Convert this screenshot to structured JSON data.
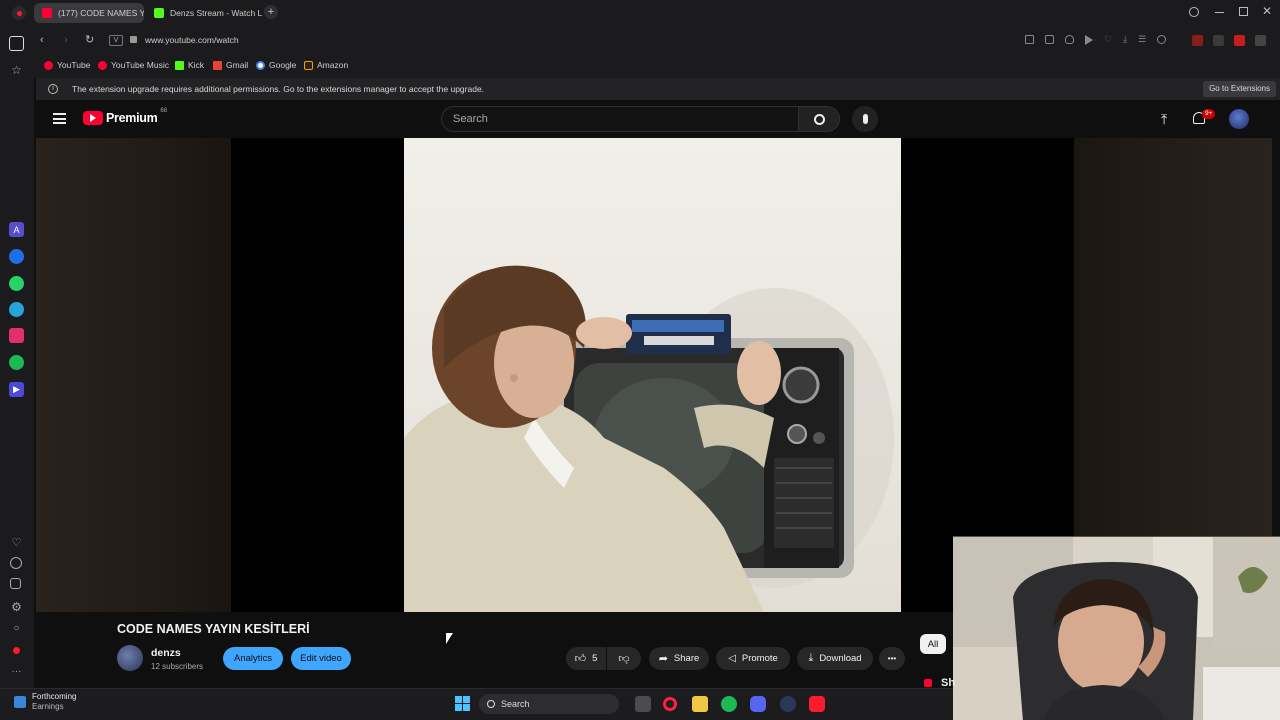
{
  "browser": {
    "tabs": [
      {
        "label": "(177) CODE NAMES Y/",
        "active": true
      },
      {
        "label": "Denzs Stream - Watch Liv",
        "active": false
      }
    ],
    "new_tab": "+",
    "url": "www.youtube.com/watch",
    "bookmarks": [
      {
        "label": "YouTube",
        "color": "#ff0033"
      },
      {
        "label": "YouTube Music",
        "color": "#ff0033"
      },
      {
        "label": "Kick",
        "color": "#53fc18"
      },
      {
        "label": "Gmail",
        "color": "#ea4335"
      },
      {
        "label": "Google",
        "color": "#4285f4"
      },
      {
        "label": "Amazon",
        "color": "#ff9900"
      }
    ],
    "infobar": {
      "message": "The extension upgrade requires additional permissions. Go to the extensions manager to accept the upgrade.",
      "button": "Go to Extensions"
    }
  },
  "youtube": {
    "logo": "Premium",
    "logo_badge": "68",
    "search_placeholder": "Search",
    "notification_count": "9+",
    "video": {
      "title": "CODE NAMES YAYIN KESİTLERİ",
      "channel": "denzs",
      "subscribers": "12 subscribers",
      "analytics": "Analytics",
      "edit": "Edit video",
      "likes": "5",
      "share": "Share",
      "promote": "Promote",
      "download": "Download",
      "more": "•••"
    },
    "chip_all": "All",
    "side_text": "Sh"
  },
  "taskbar": {
    "widget_title": "Forthcoming",
    "widget_sub": "Earnings",
    "search": "Search"
  },
  "colors": {
    "accent_blue": "#3ea6ff",
    "youtube_red": "#ff0033",
    "background": "#0f0f0f"
  }
}
